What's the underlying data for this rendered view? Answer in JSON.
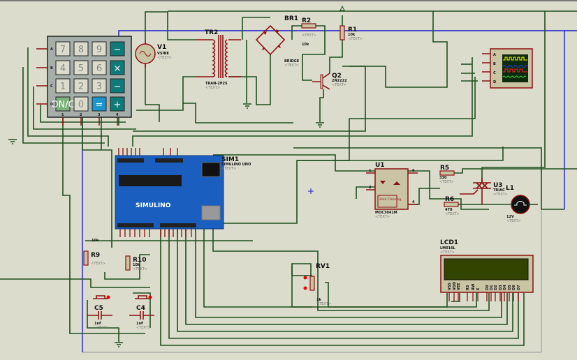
{
  "colors": {
    "wire": "#1e4f1e",
    "pin": "#8b1010",
    "bus": "#1a1ad0",
    "background": "#dcdccc",
    "arduino": "#1a5fbf",
    "lcd_screen": "#334400"
  },
  "placeholder": "<TEXT>",
  "keypad": {
    "rows": [
      "A",
      "B",
      "C",
      "D"
    ],
    "cols": [
      "1",
      "2",
      "3",
      "4"
    ],
    "keys": [
      "7",
      "8",
      "9",
      "−",
      "4",
      "5",
      "6",
      "×",
      "1",
      "2",
      "3",
      "−",
      "ON/C",
      "0",
      "=",
      "+"
    ]
  },
  "v1": {
    "ref": "V1",
    "value": "VSINE"
  },
  "tr2": {
    "ref": "TR2",
    "value": "TRAN-2P2S"
  },
  "br1": {
    "ref": "BR1",
    "value": "BRIDGE"
  },
  "r2": {
    "ref": "R2",
    "value": "10k"
  },
  "r1": {
    "ref": "R1",
    "value": "10k"
  },
  "q2": {
    "ref": "Q2",
    "value": "2N2222"
  },
  "sim1": {
    "ref": "SIM1",
    "value": "SIMULINO UNO",
    "logo": "SIMULINO"
  },
  "u1": {
    "ref": "U1",
    "value": "MOC3041M",
    "inner": "Zero Crossing",
    "pins": [
      "1",
      "2",
      "6",
      "4"
    ]
  },
  "r5": {
    "ref": "R5",
    "value": "330"
  },
  "r6": {
    "ref": "R6",
    "value": "470"
  },
  "u3": {
    "ref": "U3",
    "value": "TRIAC"
  },
  "l1": {
    "ref": "L1",
    "value": "12V"
  },
  "lcd1": {
    "ref": "LCD1",
    "value": "LM016L",
    "pins": [
      "VSS",
      "VDD",
      "VEE",
      "RS",
      "RW",
      "E",
      "D0",
      "D1",
      "D2",
      "D3",
      "D4",
      "D5",
      "D6",
      "D7"
    ]
  },
  "rv1": {
    "ref": "RV1",
    "value": "1k"
  },
  "r9": {
    "ref": "R9",
    "value": "10k"
  },
  "r10": {
    "ref": "R10",
    "value": "10k"
  },
  "c5": {
    "ref": "C5",
    "value": "1nF"
  },
  "c4": {
    "ref": "C4",
    "value": "1nF"
  },
  "scope": {
    "channels": [
      "A",
      "B",
      "C",
      "D"
    ]
  }
}
